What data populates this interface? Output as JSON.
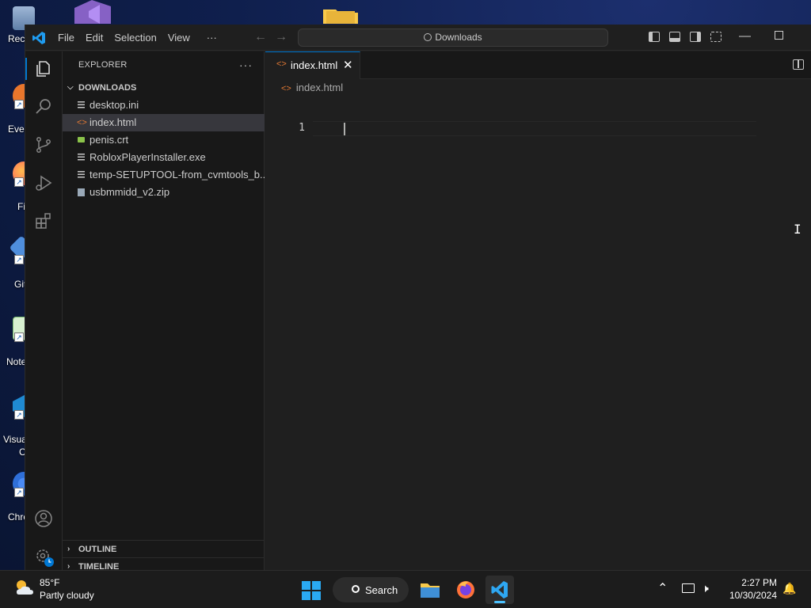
{
  "desktop": {
    "icons": [
      {
        "label": "Recy"
      },
      {
        "label": "Ever"
      },
      {
        "label": "Fi"
      },
      {
        "label": "Git"
      },
      {
        "label": "Note"
      },
      {
        "label": "Visua"
      },
      {
        "label": "C"
      },
      {
        "label": "Chro"
      }
    ]
  },
  "window": {
    "menu": [
      "File",
      "Edit",
      "Selection",
      "View",
      "···"
    ],
    "command_center": "Downloads",
    "activity_icons": [
      "explorer-icon",
      "search-icon",
      "source-control-icon",
      "run-debug-icon",
      "extensions-icon",
      "account-icon",
      "settings-icon"
    ]
  },
  "explorer": {
    "title": "EXPLORER",
    "more": "···",
    "folder": "DOWNLOADS",
    "files": [
      {
        "name": "desktop.ini",
        "icon": "lines-icon"
      },
      {
        "name": "index.html",
        "icon": "html-icon",
        "selected": true
      },
      {
        "name": "penis.crt",
        "icon": "lock-icon"
      },
      {
        "name": "RobloxPlayerInstaller.exe",
        "icon": "lines-icon"
      },
      {
        "name": "temp-SETUPTOOL-from_cvmtools_b...",
        "icon": "lines-icon"
      },
      {
        "name": "usbmmidd_v2.zip",
        "icon": "zip-icon"
      }
    ],
    "outline": "OUTLINE",
    "timeline": "TIMELINE"
  },
  "editor": {
    "tab_label": "index.html",
    "breadcrumb": "index.html",
    "line_number": "1"
  },
  "taskbar": {
    "temperature": "85°F",
    "weather": "Partly cloudy",
    "search_label": "Search",
    "time": "2:27 PM",
    "date": "10/30/2024"
  },
  "colors": {
    "accent": "#0078d4",
    "html_icon": "#e37933",
    "start_blue": "#2aa9f2"
  }
}
